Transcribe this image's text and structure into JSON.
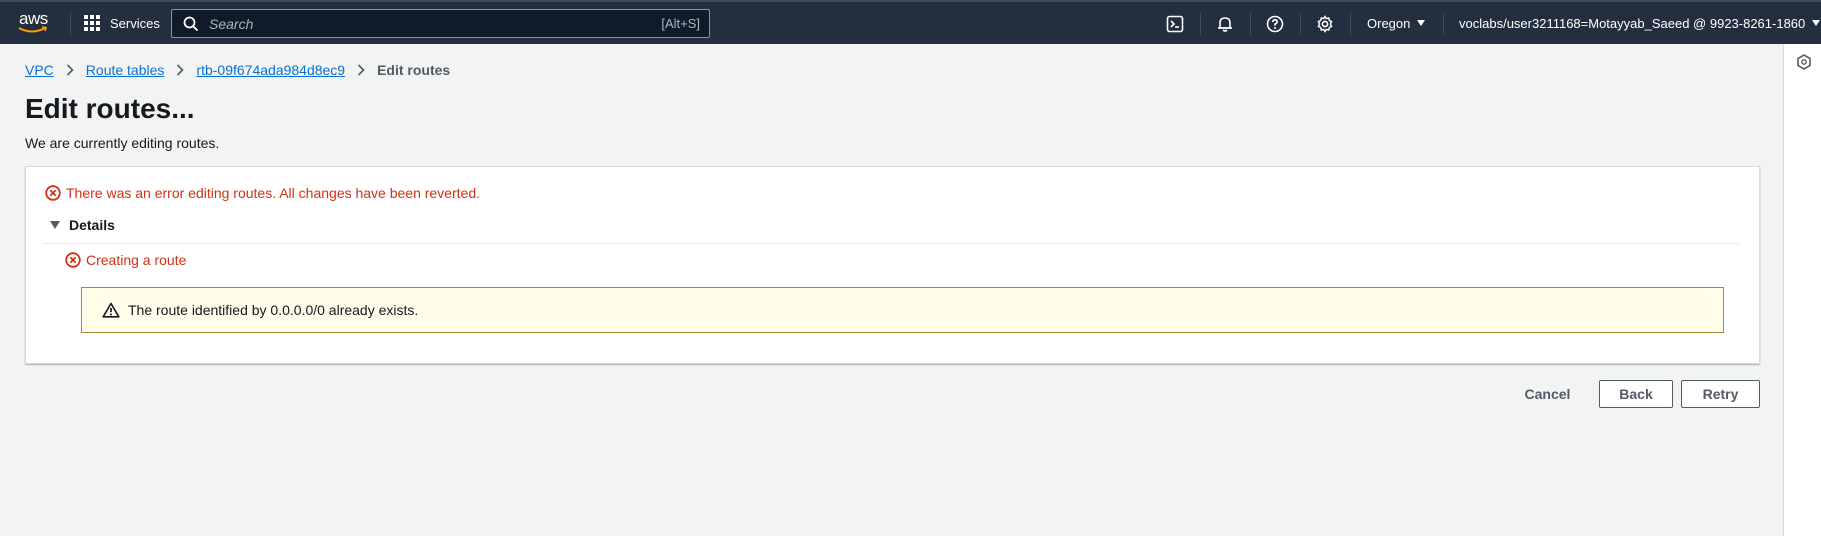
{
  "nav": {
    "logo_text": "aws",
    "services_label": "Services",
    "search_placeholder": "Search",
    "search_shortcut": "[Alt+S]",
    "region_label": "Oregon",
    "account_label": "voclabs/user3211168=Motayyab_Saeed @ 9923-8261-1860",
    "icons": [
      "cloudshell-icon",
      "notifications-icon",
      "help-icon",
      "settings-icon"
    ]
  },
  "breadcrumb": {
    "items": [
      "VPC",
      "Route tables",
      "rtb-09f674ada984d8ec9"
    ],
    "current": "Edit routes"
  },
  "page": {
    "title": "Edit routes...",
    "description": "We are currently editing routes."
  },
  "error_panel": {
    "message": "There was an error editing routes. All changes have been reverted.",
    "details_label": "Details",
    "sub_error": "Creating a route",
    "warning": "The route identified by 0.0.0.0/0 already exists."
  },
  "actions": {
    "cancel": "Cancel",
    "back": "Back",
    "retry": "Retry"
  },
  "colors": {
    "nav_bg": "#232f3e",
    "link": "#0972d3",
    "error": "#d13212",
    "warning_bg": "#fffce9",
    "warning_border": "#a78d2f"
  }
}
